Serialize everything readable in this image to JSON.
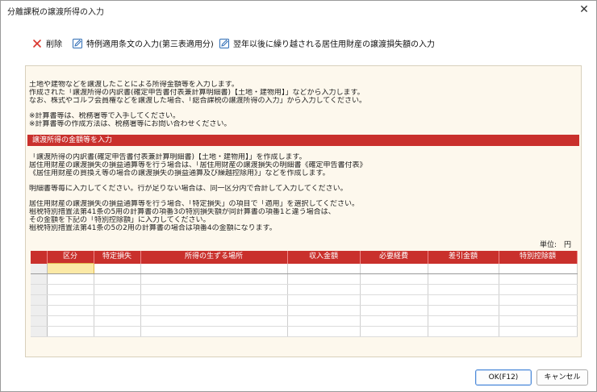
{
  "window": {
    "title": "分離課税の譲渡所得の入力",
    "close_glyph": "✕"
  },
  "toolbar": {
    "delete_label": "削除",
    "special_provision_label": "特例適用条文の入力(第三表適用分)",
    "loss_carryover_label": "翌年以後に繰り越される居住用財産の譲渡損失額の入力"
  },
  "intro_lines": [
    "土地や建物などを譲渡したことによる所得金額等を入力します。",
    "作成された「譲渡所得の内訳書(確定申告書付表兼計算明細書)【土地・建物用】」などから入力します。",
    "なお、株式やゴルフ会員権などを譲渡した場合、「総合課税の譲渡所得の入力」から入力してください。",
    "",
    "※計算書等は、税務署等で入手してください。",
    "※計算書等の作成方法は、税務署等にお問い合わせください。"
  ],
  "section": {
    "title": "譲渡所得の金額等を入力"
  },
  "body_lines": [
    "「譲渡所得の内訳書(確定申告書付表兼計算明細書)【土地・建物用】」を作成します。",
    "居住用財産の譲渡損失の損益通算等を行う場合は、「居住用財産の譲渡損失の明細書《確定申告書付表》",
    "《居住用財産の買換え等の場合の譲渡損失の損益通算及び繰越控除用》」などを作成します。",
    "",
    "明細書等毎に入力してください。行が足りない場合は、同一区分内で合計して入力してください。",
    "",
    "居住用財産の譲渡損失の損益通算等を行う場合、「特定損失」の項目で「適用」を選択してください。",
    "租税特別措置法第41条の5用の計算書の項番3の特別損失額が同計算書の項番1と違う場合は、",
    "その金額を下記の「特別控除額」に入力してください。",
    "租税特別措置法第41条の5の2用の計算書の場合は項番4の金額になります。"
  ],
  "unit": {
    "label": "単位:　円"
  },
  "table": {
    "columns": [
      "区分",
      "特定損失",
      "所得の生ずる場所",
      "収入金額",
      "必要経費",
      "差引金額",
      "特別控除額"
    ],
    "rows": [
      [
        "",
        "",
        "",
        "",
        "",
        "",
        ""
      ],
      [
        "",
        "",
        "",
        "",
        "",
        "",
        ""
      ],
      [
        "",
        "",
        "",
        "",
        "",
        "",
        ""
      ],
      [
        "",
        "",
        "",
        "",
        "",
        "",
        ""
      ],
      [
        "",
        "",
        "",
        "",
        "",
        "",
        ""
      ],
      [
        "",
        "",
        "",
        "",
        "",
        "",
        ""
      ],
      [
        "",
        "",
        "",
        "",
        "",
        "",
        ""
      ]
    ]
  },
  "buttons": {
    "ok_label": "OK(F12)",
    "cancel_label": "キャンセル"
  },
  "colors": {
    "section_header": "#c9302c",
    "panel_background": "#fdf8ed",
    "selected_cell": "#fbe9a6",
    "delete_icon": "#d9342b",
    "edit_icon": "#2f6db5"
  },
  "icons": {
    "delete": "delete-x-icon",
    "edit": "pencil-edit-icon"
  }
}
